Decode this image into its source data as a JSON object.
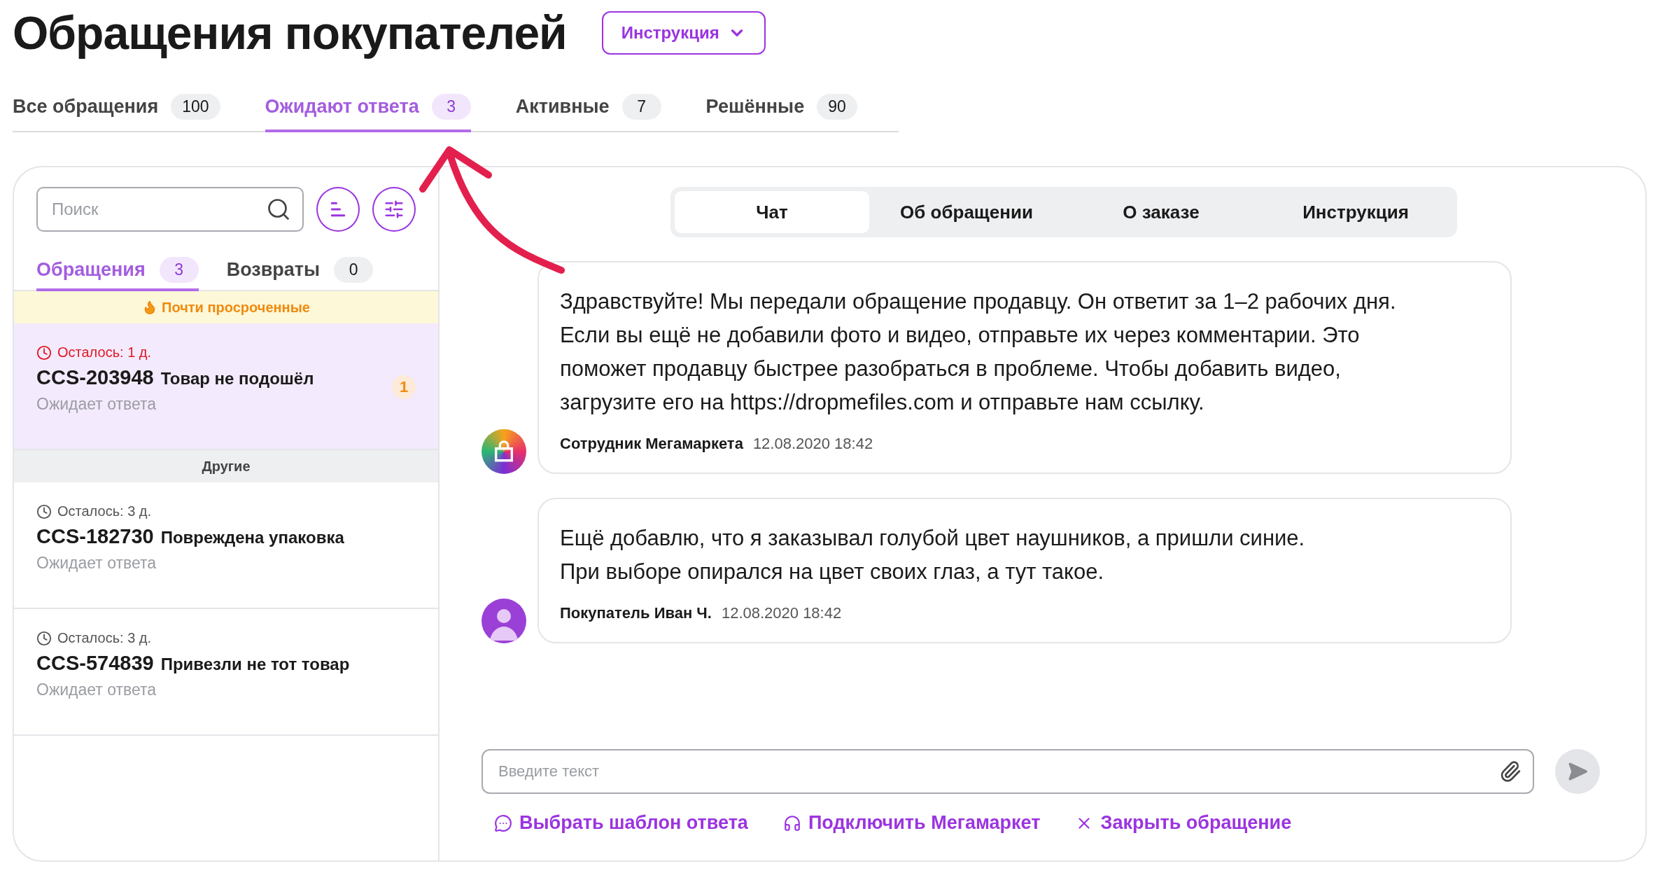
{
  "header": {
    "title": "Обращения покупателей",
    "instruction_button": "Инструкция"
  },
  "status_tabs": [
    {
      "label": "Все обращения",
      "count": "100",
      "selected": false
    },
    {
      "label": "Ожидают ответа",
      "count": "3",
      "selected": true
    },
    {
      "label": "Активные",
      "count": "7",
      "selected": false
    },
    {
      "label": "Решённые",
      "count": "90",
      "selected": false
    }
  ],
  "sidebar": {
    "search": {
      "placeholder": "Поиск"
    },
    "tabs": [
      {
        "label": "Обращения",
        "count": "3",
        "selected": true
      },
      {
        "label": "Возвраты",
        "count": "0",
        "selected": false
      }
    ],
    "groups": [
      {
        "kind": "urgent",
        "title": "Почти просроченные",
        "items": [
          {
            "remaining": "Осталось: 1 д.",
            "id": "CCS-203948",
            "subject": "Товар не подошёл",
            "status": "Ожидает ответа",
            "unread": "1",
            "selected": true
          }
        ]
      },
      {
        "kind": "other",
        "title": "Другие",
        "items": [
          {
            "remaining": "Осталось: 3 д.",
            "id": "CCS-182730",
            "subject": "Повреждена упаковка",
            "status": "Ожидает ответа",
            "selected": false
          },
          {
            "remaining": "Осталось: 3 д.",
            "id": "CCS-574839",
            "subject": "Привезли не тот товар",
            "status": "Ожидает ответа",
            "selected": false
          }
        ]
      }
    ]
  },
  "detail": {
    "tabs": [
      {
        "label": "Чат",
        "selected": true
      },
      {
        "label": "Об обращении",
        "selected": false
      },
      {
        "label": "О заказе",
        "selected": false
      },
      {
        "label": "Инструкция",
        "selected": false
      }
    ],
    "messages": [
      {
        "kind": "staff",
        "text": "Здравствуйте! Мы передали обращение продавцу. Он ответит за 1–2 рабочих дня. Если вы ещё не добавили фото и видео, отправьте их через комментарии. Это поможет продавцу быстрее разобраться в проблеме. Чтобы добавить видео, загрузите его на https://dropmefiles.com и отправьте нам ссылку.",
        "author": "Сотрудник Мегамаркета",
        "time": "12.08.2020 18:42"
      },
      {
        "kind": "buyer",
        "text": "Ещё добавлю, что я заказывал голубой цвет наушников, а пришли синие.\nПри выборе опирался на цвет своих глаз, а тут такое.",
        "author": "Покупатель Иван Ч.",
        "time": "12.08.2020 18:42"
      }
    ],
    "composer": {
      "placeholder": "Введите текст"
    },
    "actions": [
      {
        "kind": "template",
        "label": "Выбрать шаблон ответа"
      },
      {
        "kind": "connect",
        "label": "Подключить Мегамаркет"
      },
      {
        "kind": "close",
        "label": "Закрыть обращение"
      }
    ]
  }
}
